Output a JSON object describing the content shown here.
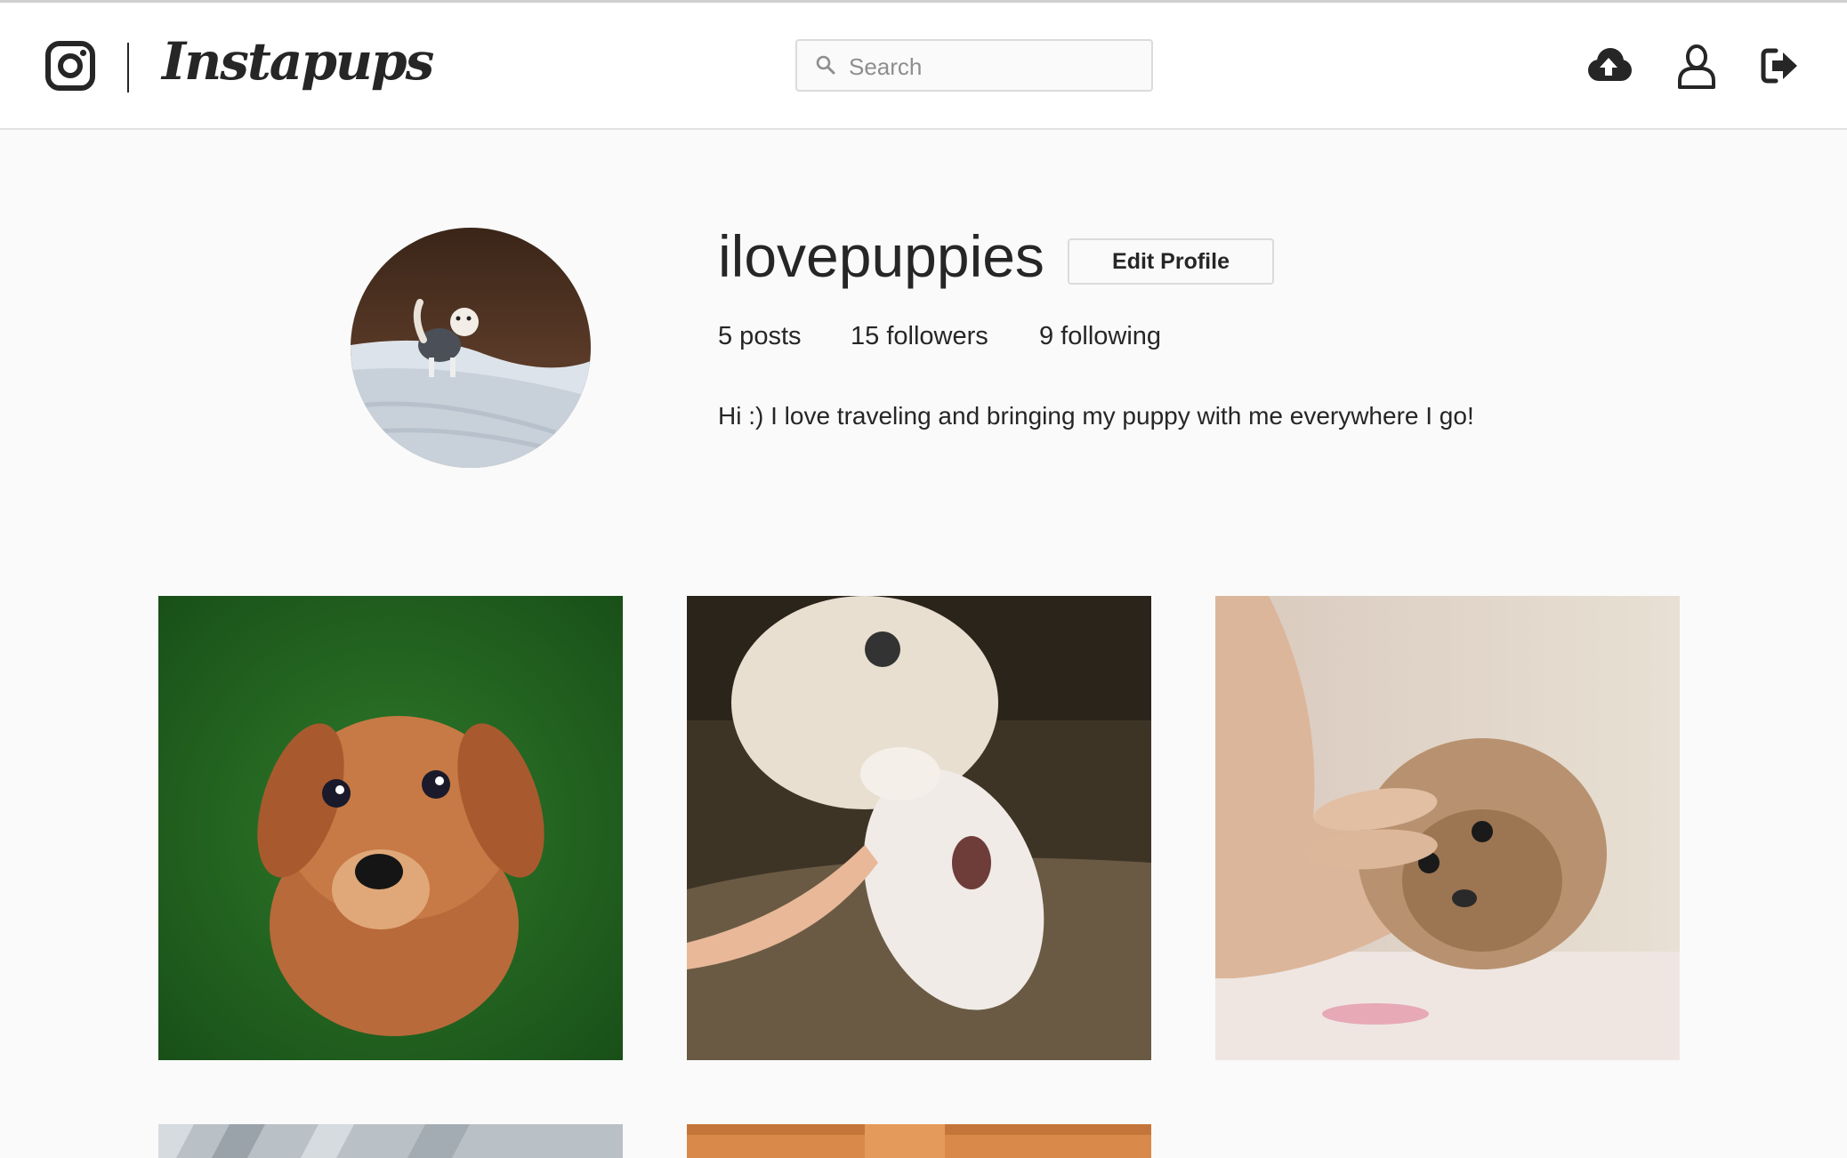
{
  "header": {
    "brand": "Instapups",
    "search": {
      "placeholder": "Search",
      "value": ""
    },
    "icons": [
      "instagram-logo-icon",
      "search-icon",
      "cloud-upload-icon",
      "user-icon",
      "sign-out-icon"
    ]
  },
  "profile": {
    "username": "ilovepuppies",
    "edit_label": "Edit Profile",
    "posts": "5 posts",
    "followers": "15 followers",
    "following": "9 following",
    "bio": "Hi :) I love traveling and bringing my puppy with me everywhere I go!"
  },
  "colors": {
    "background": "#fafafa",
    "header_bg": "#ffffff",
    "text": "#262626",
    "border": "#dbdbdb"
  }
}
